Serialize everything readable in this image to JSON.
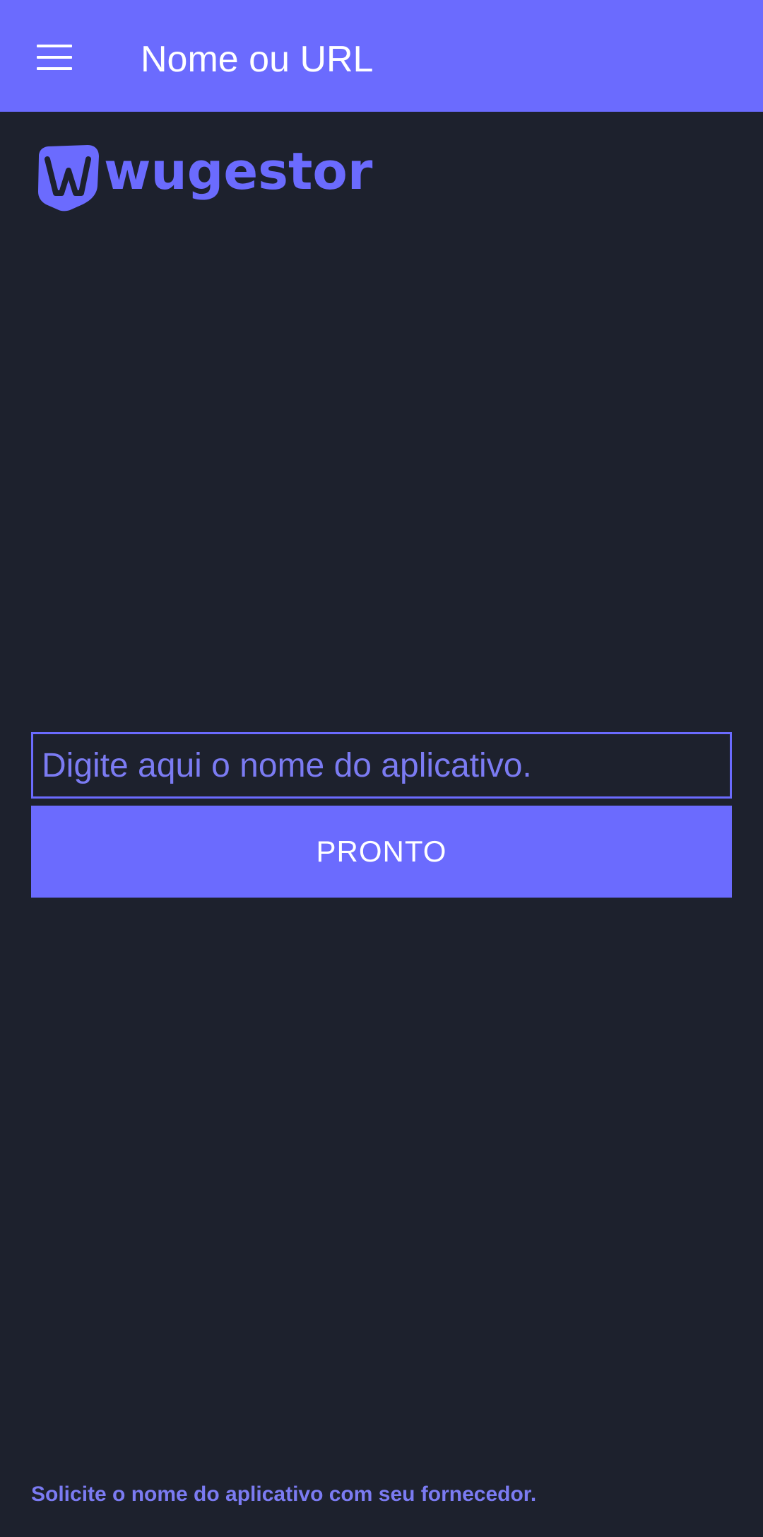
{
  "app_bar": {
    "title": "Nome ou URL",
    "menu_icon": "hamburger-menu-icon",
    "background_color": "#6b6bfe"
  },
  "logo": {
    "text": "wugestor",
    "color": "#6b6bfe"
  },
  "form": {
    "input_placeholder": "Digite aqui o nome do aplicativo.",
    "input_value": "",
    "button_label": "PRONTO"
  },
  "footer": {
    "hint": "Solicite o nome do aplicativo com seu fornecedor."
  },
  "colors": {
    "background": "#1d212d",
    "accent": "#6b6bfe",
    "accent_text": "#7b7bf2"
  }
}
